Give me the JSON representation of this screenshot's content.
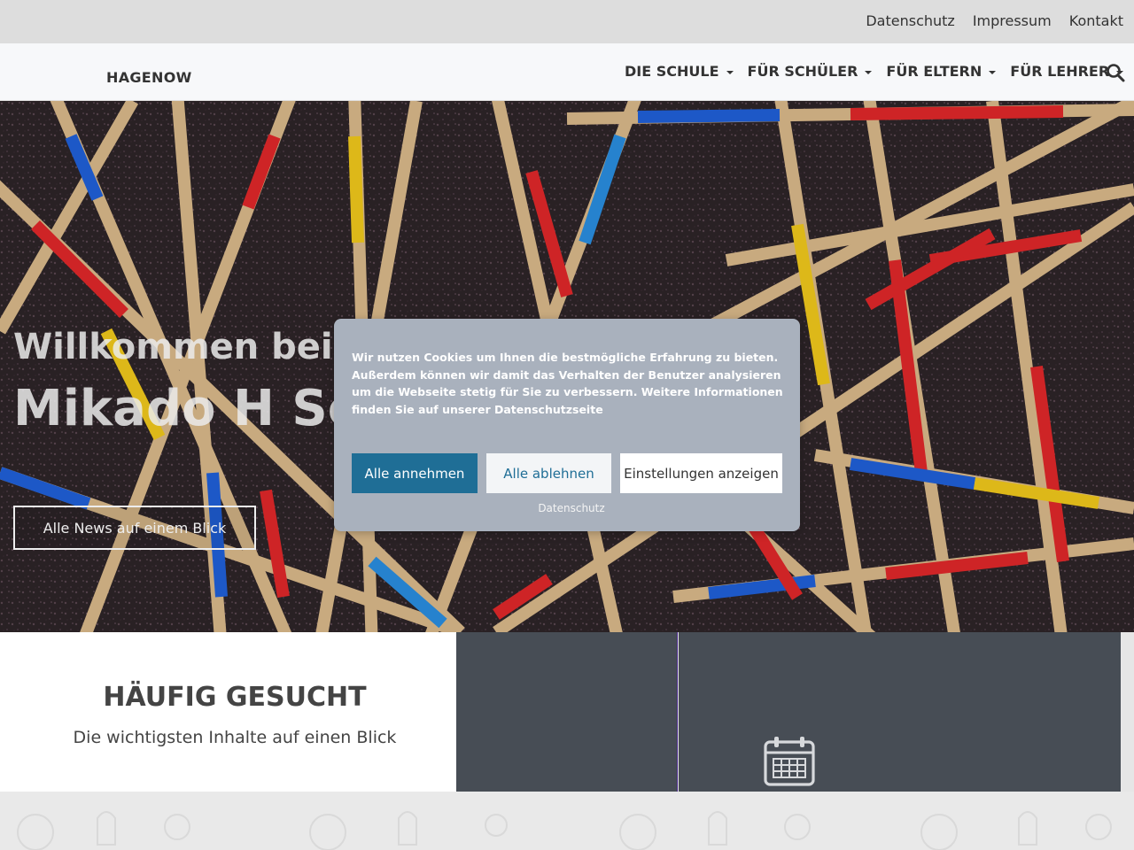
{
  "topbar": {
    "links": [
      "Datenschutz",
      "Impressum",
      "Kontakt"
    ]
  },
  "header": {
    "brand": "HAGENOW",
    "nav": [
      "DIE SCHULE",
      "FÜR SCHÜLER",
      "FÜR ELTERN",
      "FÜR LEHRER"
    ],
    "search_icon": "search-icon"
  },
  "hero": {
    "line1": "Willkommen bei d",
    "line2": "Mikado H Sc",
    "button": "Alle News auf einem Blick"
  },
  "lower": {
    "title": "HÄUFIG GESUCHT",
    "subtitle": "Die wichtigsten Inhalte auf einen Blick",
    "tile_icon": "calendar-icon"
  },
  "cookie": {
    "text": "Wir nutzen Cookies um Ihnen die bestmögliche Erfahrung zu bieten. Außerdem können wir damit das Verhalten der Benutzer analysieren um die Webseite stetig für Sie zu verbessern. Weitere Informationen finden Sie auf unserer Datenschutzseite",
    "accept": "Alle annehmen",
    "reject": "Alle ablehnen",
    "settings": "Einstellungen anzeigen",
    "link": "Datenschutz"
  },
  "colors": {
    "accent": "#1f6e96",
    "tile": "#474d55",
    "banner": "#a9b1bd"
  }
}
